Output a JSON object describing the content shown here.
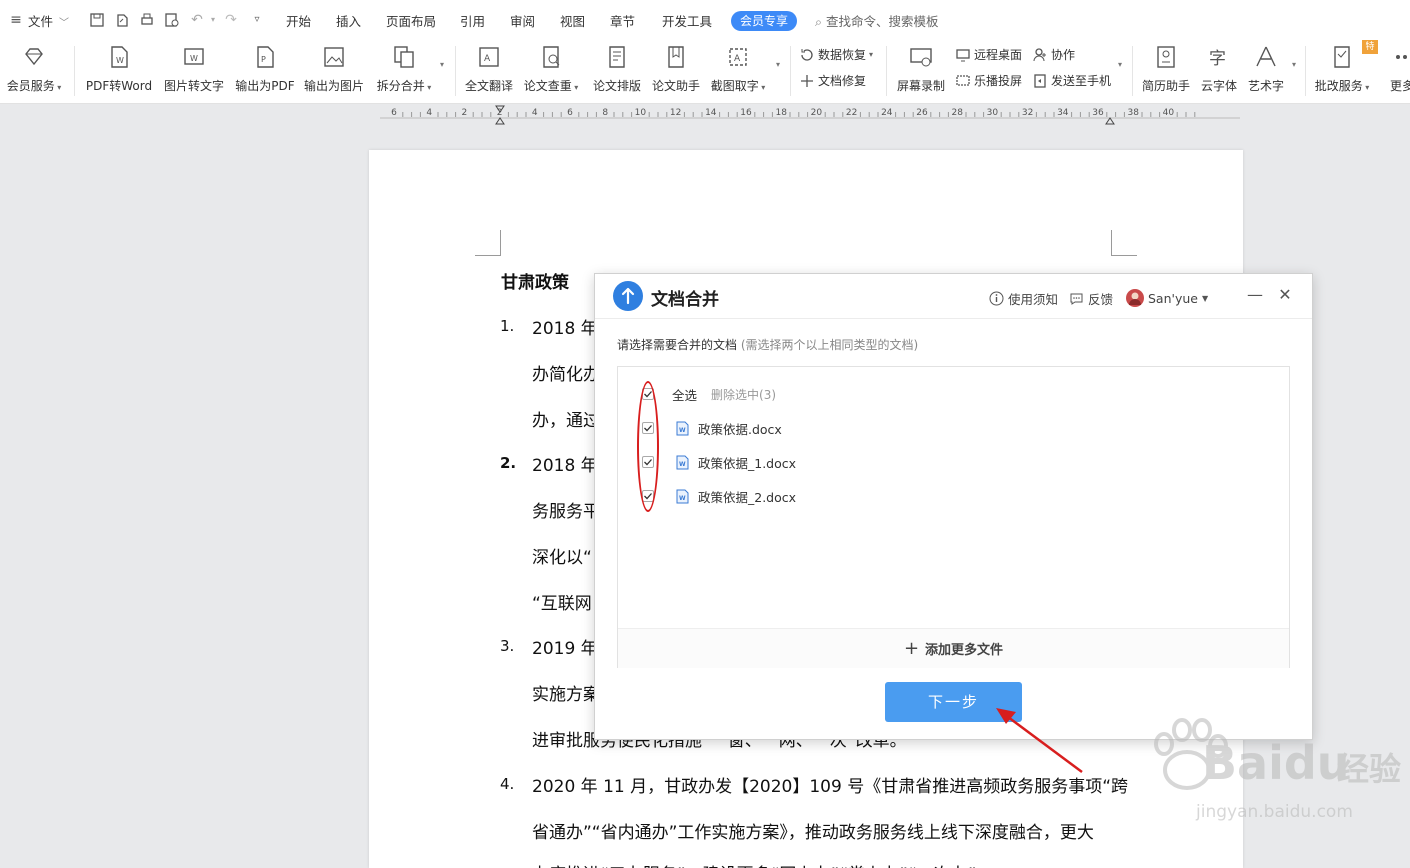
{
  "menubar": {
    "file_label": "文件",
    "tabs": [
      "开始",
      "插入",
      "页面布局",
      "引用",
      "审阅",
      "视图",
      "章节",
      "开发工具"
    ],
    "vip_tab": "会员专享",
    "search_placeholder": "查找命令、搜索模板"
  },
  "ribbon": {
    "member_service": "会员服务",
    "pdf_to_word": "PDF转Word",
    "image_to_text": "图片转文字",
    "export_pdf": "输出为PDF",
    "export_image": "输出为图片",
    "split_merge": "拆分合并",
    "full_translate": "全文翻译",
    "paper_check": "论文查重",
    "paper_layout": "论文排版",
    "paper_assistant": "论文助手",
    "screenshot_text": "截图取字",
    "data_recovery": "数据恢复",
    "doc_repair": "文档修复",
    "screen_record": "屏幕录制",
    "remote_desktop": "远程桌面",
    "cast_screen": "乐播投屏",
    "collaborate": "协作",
    "send_to_phone": "发送至手机",
    "resume_assistant": "简历助手",
    "cloud_font": "云字体",
    "art_text": "艺术字",
    "review_service": "批改服务",
    "more": "更多"
  },
  "ruler": {
    "ticks": [
      "6",
      "4",
      "2",
      "2",
      "4",
      "6",
      "8",
      "10",
      "12",
      "14",
      "16",
      "18",
      "20",
      "22",
      "24",
      "26",
      "28",
      "30",
      "32",
      "34",
      "36",
      "38",
      "40"
    ]
  },
  "document": {
    "title": "甘肃政策",
    "items": [
      {
        "num": "1.",
        "lines": [
          "2018 年",
          "办简化办",
          "办，通过"
        ]
      },
      {
        "num": "2.",
        "lines": [
          "2018 年",
          "务服务平",
          "深化以“",
          "“互联网"
        ]
      },
      {
        "num": "3.",
        "lines": [
          "2019 年",
          "实施方案",
          "进审批服务便民化措施“一窗、一网、一次”改革。"
        ]
      },
      {
        "num": "4.",
        "lines": [
          "2020 年 11 月，甘政办发【2020】109 号《甘肃省推进高频政务服务事项“跨",
          "省通办”“省内通办”工作实施方案》，推动政务服务线上线下深度融合，更大",
          "力度推进“五办服务”，建设更多“网上办”“掌上办”“一次办”。"
        ]
      }
    ]
  },
  "dialog": {
    "title": "文档合并",
    "help": "使用须知",
    "feedback": "反馈",
    "user": "San'yue",
    "instruction": "请选择需要合并的文档",
    "instruction_hint": "(需选择两个以上相同类型的文档)",
    "select_all": "全选",
    "delete_selected": "删除选中(3)",
    "files": [
      "政策依据.docx",
      "政策依据_1.docx",
      "政策依据_2.docx"
    ],
    "add_more": "添加更多文件",
    "next": "下一步"
  },
  "watermark": {
    "brand": "Baidu",
    "brand_cn": "经验",
    "url": "jingyan.baidu.com"
  },
  "colors": {
    "accent": "#3d8af7",
    "next_button": "#4a9cf0",
    "annotation_red": "#d81e1e"
  }
}
